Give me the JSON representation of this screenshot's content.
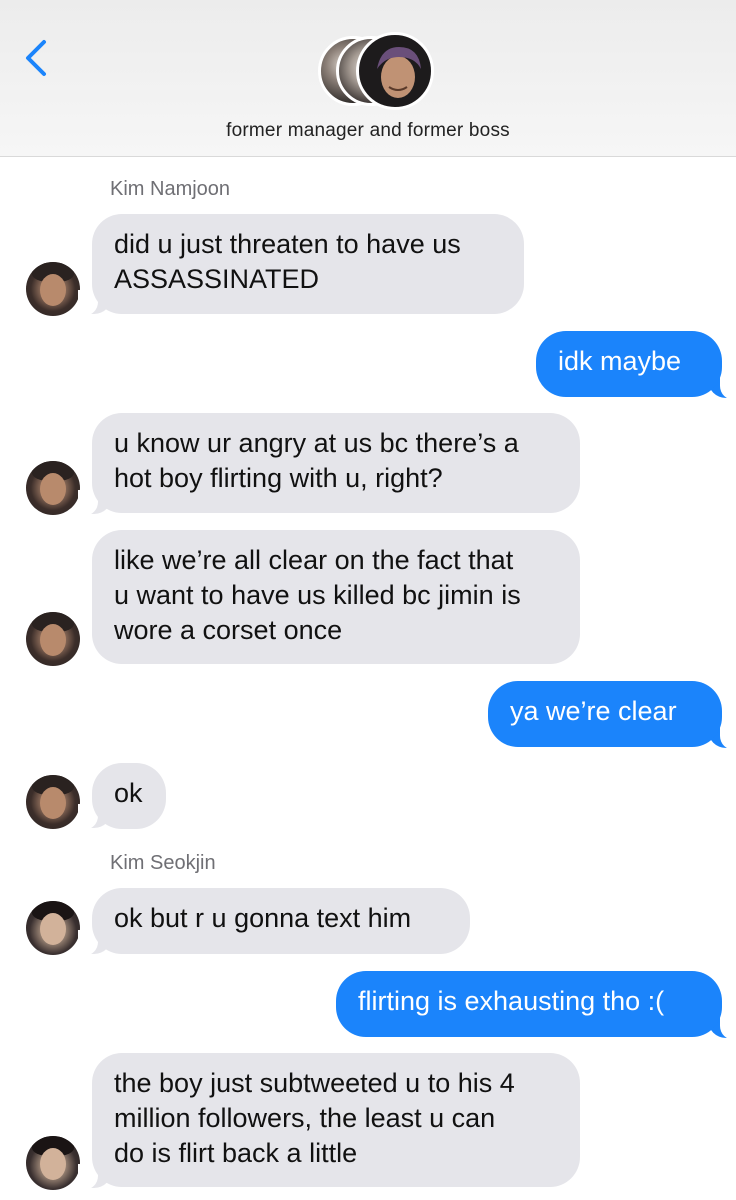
{
  "header": {
    "back_icon": "chevron-left-icon",
    "group_name": "former manager and former boss",
    "accent_color": "#1b84fb"
  },
  "messages": [
    {
      "sender": "Kim Namjoon"
    },
    {
      "text": "did u just threaten to have us\nASSASSINATED",
      "direction": "incoming"
    },
    {
      "text": "idk maybe",
      "direction": "outgoing"
    },
    {
      "text": "u know ur angry at us bc there’s a\nhot boy flirting with u, right?",
      "direction": "incoming"
    },
    {
      "text": "like we’re all clear on the fact that\nu want to have us killed bc jimin is\nwore a corset once",
      "direction": "incoming"
    },
    {
      "text": "ya we’re clear",
      "direction": "outgoing"
    },
    {
      "text": "ok",
      "direction": "incoming"
    },
    {
      "sender": "Kim Seokjin"
    },
    {
      "text": "ok but r u gonna text him",
      "direction": "incoming"
    },
    {
      "text": "flirting is exhausting tho :(",
      "direction": "outgoing"
    },
    {
      "text": "the boy just subtweeted u to his 4\nmillion followers, the least u can\ndo is flirt back a little",
      "direction": "incoming"
    }
  ]
}
